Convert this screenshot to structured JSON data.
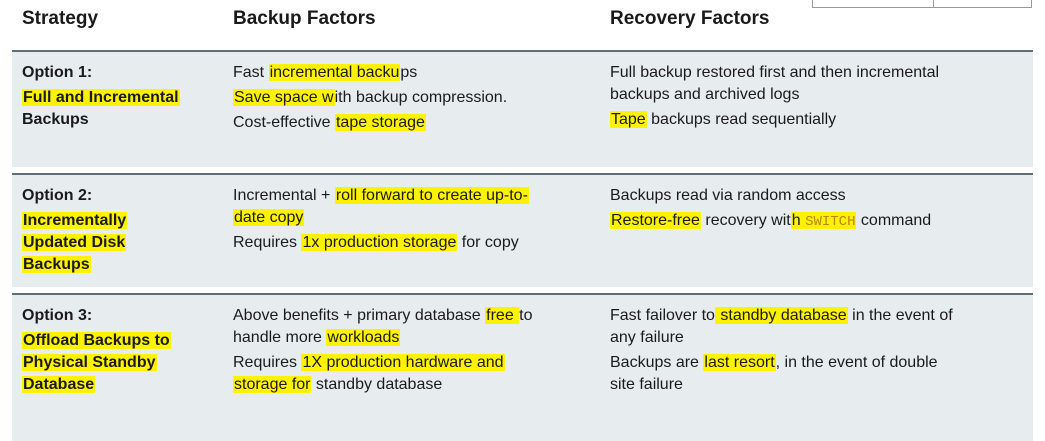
{
  "headers": {
    "strategy": "Strategy",
    "backup": "Backup Factors",
    "recovery": "Recovery Factors"
  },
  "rows": [
    {
      "option": "Option 1:",
      "name_hl": "Full and Incremental",
      "name_rest": "Backups",
      "b1_pre": "Fast ",
      "b1_hl": "incremental backu",
      "b1_post": "ps",
      "b2_hl": "Save space w",
      "b2_post": "ith backup compression.",
      "b3_pre": "Cost-effective ",
      "b3_hl": "tape storage",
      "r1": "Full backup restored first and then incremental",
      "r1b": "backups and archived logs",
      "r2_hl": "Tape",
      "r2_post": " backups read sequentially"
    },
    {
      "option": "Option 2:",
      "name_hl1": "Incrementally",
      "name_hl2": "Updated Disk",
      "name_hl3": "Backups",
      "b1_pre": "Incremental + ",
      "b1_hl": "roll forward to create up-to-",
      "b1b_hl": "date copy",
      "b2_pre": "Requires ",
      "b2_hl": "1x production storage",
      "b2_post": " for copy",
      "r1": "Backups read via random access",
      "r2_hl": "Restore-free",
      "r2_mid": " recovery wit",
      "r2_hl2": "h ",
      "r2_cmd": "SWITCH",
      "r2_post": " command"
    },
    {
      "option": "Option 3:",
      "name_hl1": "Offload Backups to",
      "name_hl2": "Physical Standby",
      "name_hl3": "Database",
      "b1_pre": "Above benefits + primary database ",
      "b1_hl": "free ",
      "b1_post": "to",
      "b1b_pre": "handle more ",
      "b1b_hl": "workloads",
      "b2_pre": "Requires ",
      "b2_hl": "1X production hardware and",
      "b2b_hl": "storage for",
      "b2b_post": " standby database",
      "r1_pre": "Fast failover to",
      "r1_hl": " standby database",
      "r1_post": " in the event of",
      "r1b": "any failure",
      "r2_pre": "Backups are ",
      "r2_hl": "last resort",
      "r2_post": ", in the event of double",
      "r2b": "site failure"
    }
  ]
}
